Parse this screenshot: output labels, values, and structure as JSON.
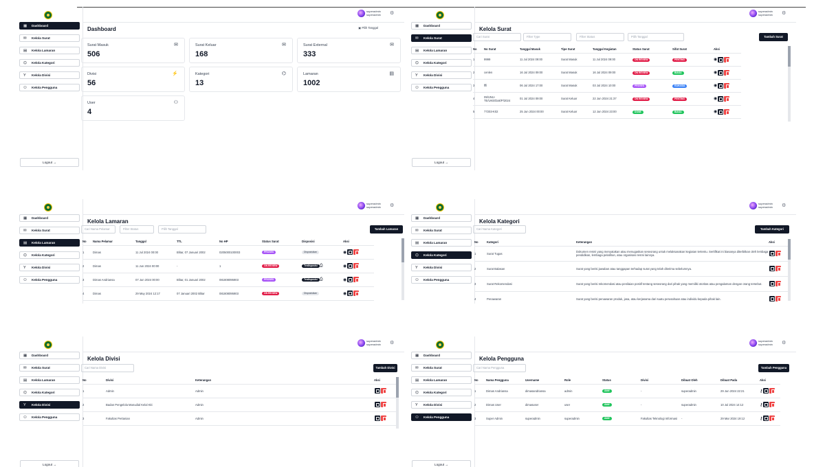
{
  "common": {
    "nav": [
      "Dashboard",
      "Kelola Surat",
      "Kelola Lamaran",
      "Kelola Kategori",
      "Kelola Divisi",
      "Kelola Pengguna"
    ],
    "nav_icons": [
      "grid-icon",
      "mail-icon",
      "file-icon",
      "tag-icon",
      "branch-icon",
      "users-icon"
    ],
    "logout": "Logout",
    "user_name": "superadmin",
    "user_role": "superadmin"
  },
  "dashboard": {
    "title": "Dashboard",
    "date_filter": "Pilih Tanggal",
    "cards": [
      {
        "label": "Surat Masuk",
        "value": "506"
      },
      {
        "label": "Surat Keluar",
        "value": "168"
      },
      {
        "label": "Surat External",
        "value": "333"
      },
      {
        "label": "Divisi",
        "value": "56"
      },
      {
        "label": "Kategori",
        "value": "13"
      },
      {
        "label": "Lamaran",
        "value": "1002"
      },
      {
        "label": "User",
        "value": "4"
      }
    ]
  },
  "surat": {
    "title": "Kelola Surat",
    "search": "Cari Surat",
    "filter_type": "Filter Type",
    "filter_status": "Filter Status",
    "date": "Pilih Tanggal",
    "add": "Tambah Surat",
    "headers": [
      "No",
      "No Surat",
      "Tanggal Masuk",
      "Tipe Surat",
      "Tanggal Kegiatan",
      "Status Surat",
      "Sifat Surat",
      "Aksi"
    ],
    "rows": [
      [
        "1",
        "9999",
        "11 Jul 2024 09:00",
        "Surat Masuk",
        "11 Jul 2024 09:00",
        "ON REVIEW",
        "PENTING"
      ],
      [
        "2",
        "cenlen",
        "16 Jul 2024 09:00",
        "Surat Masuk",
        "16 Jul 2024 09:00",
        "ON REVIEW",
        "BIASA"
      ],
      [
        "3",
        "fffi",
        "06 Jul 2024 17:00",
        "Surat Masuk",
        "03 Jul 2024 10:00",
        "PROSES",
        "RAHASIA"
      ],
      [
        "4",
        "09/UNU-TE/UKE/Dak/P/2024",
        "01 Jul 2024 09:00",
        "Surat Keluar",
        "22 Jun 2024 21:37",
        "ON REVIEW",
        "PENTING"
      ],
      [
        "5",
        "77203-K02",
        "25 Jun 2024 00:00",
        "Surat Keluar",
        "12 Jun 2024 23:00",
        "DONE",
        "BIASA"
      ]
    ]
  },
  "lamaran": {
    "title": "Kelola Lamaran",
    "search": "Cari Nama Pelamar",
    "filter": "Filter Status",
    "date": "Pilih Tanggal",
    "add": "Tambah Lamaran",
    "headers": [
      "No",
      "Nama Pelamar",
      "Tanggal",
      "TTL",
      "No HP",
      "Status Surat",
      "Disposisi",
      "Aksi"
    ],
    "rows": [
      [
        "1",
        "Dimas",
        "11 Jul 2024 00:00",
        "Blitar, 07 Januari 2002",
        "0205000100003",
        "PROSES",
        "Disposisikan"
      ],
      [
        "2",
        "Dimas",
        "11 Jun 2024 00:00",
        "-",
        "1",
        "ON REVIEW",
        "Terdisposisi"
      ],
      [
        "3",
        "Dimas Andriansa",
        "07 Jun 2024 00:00",
        "Blitar, 01 Januari 2002",
        "081808095903",
        "PROSES",
        "Terdisposisi"
      ],
      [
        "4",
        "Dimas",
        "29 May 2024 12:17",
        "07 Januari 2002 Blitar",
        "081808095903",
        "ON REVIEW",
        "Disposisikan"
      ]
    ]
  },
  "kategori": {
    "title": "Kelola Kategori",
    "search": "Cari Nama Kategori",
    "add": "Tambah Kategori",
    "headers": [
      "No",
      "Kategori",
      "Keterangan",
      "Aksi"
    ],
    "rows": [
      [
        "1",
        "Surat Tugas",
        "Dokumen resmi yang menyatakan atau menugaskan seseorang untuk melaksanakan kegiatan tertentu. Sertifikat ini biasanya diterbitkan oleh lembaga pendidikan, lembaga pelatihan, atau organisasi resmi lainnya."
      ],
      [
        "2",
        "Surat Balasan",
        "Surat yang berisi jawaban atau tanggapan terhadap surat yang telah diterima sebelumnya."
      ],
      [
        "3",
        "Surat Rekomendasi",
        "Surat yang berisi rekomendasi atau penilaian positif tentang seseorang dari pihak yang memiliki otoritas atau pengalaman dengan orang tersebut."
      ],
      [
        "4",
        "Penawaran",
        "Surat yang berisi penawaran produk, jasa, atau kerjasama dari suatu perusahaan atau individu kepada pihak lain."
      ]
    ]
  },
  "divisi": {
    "title": "Kelola Divisi",
    "search": "Cari Nama Divisi",
    "add": "Tambah Divisi",
    "headers": [
      "No",
      "Divisi",
      "Keterangan",
      "Aksi"
    ],
    "rows": [
      [
        "1",
        "Admin",
        "Admin"
      ],
      [
        "2",
        "Badan Pengelola Manudial Kelal Kiti",
        "Admin"
      ],
      [
        "3",
        "Fakultas Pertanian",
        "Admin"
      ]
    ]
  },
  "pengguna": {
    "title": "Kelola Pengguna",
    "search": "Cari Nama Pengguna",
    "add": "Tambah Pengguna",
    "headers": [
      "No",
      "Nama Pengguna",
      "Username",
      "Role",
      "Status",
      "Divisi",
      "Dibuat Oleh",
      "Dibuat Pada",
      "Aksi"
    ],
    "rows": [
      [
        "1",
        "Dimas Andriansa",
        "dimasandriansa",
        "admin",
        "Aktif",
        "-",
        "superadmin",
        "29 Jun 2024 22:21"
      ],
      [
        "2",
        "Dimas User",
        "dimasuser",
        "user",
        "Aktif",
        "-",
        "superadmin",
        "10 Jul 2024 14:12"
      ],
      [
        "3",
        "Super Admin",
        "superadmin",
        "superadmin",
        "Aktif",
        "Fakultas Teknologi Informasi",
        "-",
        "29 Mar 2024 19:12"
      ]
    ]
  }
}
